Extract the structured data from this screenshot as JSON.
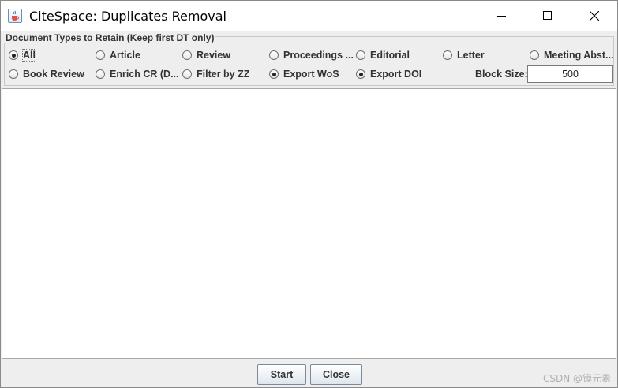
{
  "window": {
    "title": "CiteSpace: Duplicates Removal",
    "icon": "java-cup-icon"
  },
  "panel": {
    "legend": "Document Types to Retain (Keep first DT only)",
    "row1": [
      {
        "label": "All",
        "selected": true
      },
      {
        "label": "Article",
        "selected": false
      },
      {
        "label": "Review",
        "selected": false
      },
      {
        "label": "Proceedings ...",
        "selected": false
      },
      {
        "label": "Editorial",
        "selected": false
      },
      {
        "label": "Letter",
        "selected": false
      },
      {
        "label": "Meeting Abst...",
        "selected": false
      }
    ],
    "row2": [
      {
        "label": "Book Review",
        "selected": false
      },
      {
        "label": "Enrich CR (D...",
        "selected": false
      },
      {
        "label": "Filter by ZZ",
        "selected": false
      },
      {
        "label": "Export WoS",
        "selected": true
      },
      {
        "label": "Export DOI",
        "selected": true
      }
    ],
    "block_size_label": "Block Size:",
    "block_size_value": "500"
  },
  "buttons": {
    "start": "Start",
    "close": "Close"
  },
  "watermark": "CSDN @镆元素"
}
